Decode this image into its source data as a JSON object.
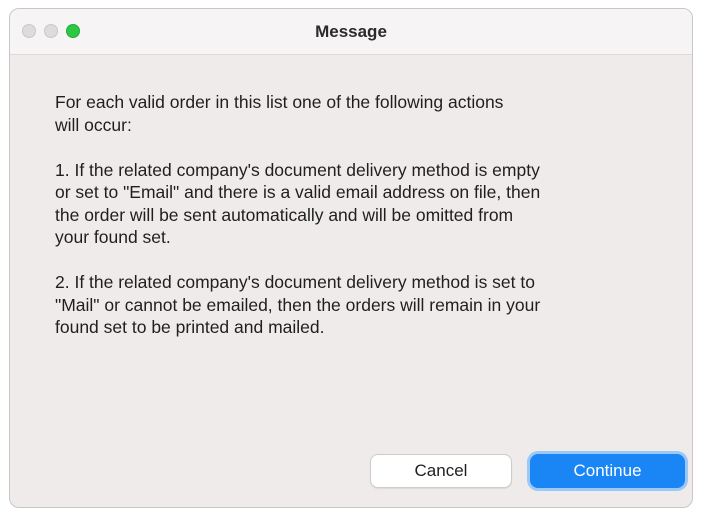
{
  "window": {
    "title": "Message"
  },
  "message": {
    "paragraphs": [
      "For each valid order in this list one of the following actions\nwill occur:",
      "1. If the related company's document delivery method is empty\nor set to \"Email\" and there is a valid email address on file, then\nthe order will be sent automatically and will be omitted from\nyour found set.",
      "2. If the related company's document delivery method is set to\n\"Mail\" or cannot be emailed, then the orders will remain in your\nfound set to be printed and mailed."
    ]
  },
  "buttons": {
    "cancel_label": "Cancel",
    "continue_label": "Continue"
  },
  "colors": {
    "accent": "#1a86f5",
    "zoom_button": "#2cc841",
    "dialog_background": "#efebeb"
  }
}
